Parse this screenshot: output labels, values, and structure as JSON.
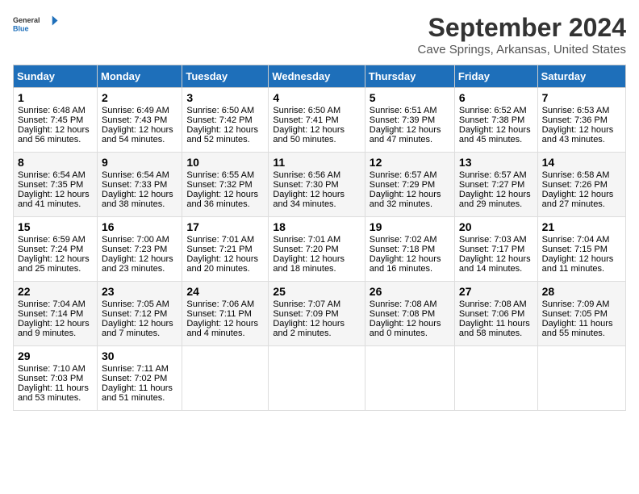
{
  "logo": {
    "line1": "General",
    "line2": "Blue"
  },
  "title": "September 2024",
  "subtitle": "Cave Springs, Arkansas, United States",
  "days_of_week": [
    "Sunday",
    "Monday",
    "Tuesday",
    "Wednesday",
    "Thursday",
    "Friday",
    "Saturday"
  ],
  "weeks": [
    [
      {
        "day": "1",
        "sunrise": "Sunrise: 6:48 AM",
        "sunset": "Sunset: 7:45 PM",
        "daylight": "Daylight: 12 hours and 56 minutes."
      },
      {
        "day": "2",
        "sunrise": "Sunrise: 6:49 AM",
        "sunset": "Sunset: 7:43 PM",
        "daylight": "Daylight: 12 hours and 54 minutes."
      },
      {
        "day": "3",
        "sunrise": "Sunrise: 6:50 AM",
        "sunset": "Sunset: 7:42 PM",
        "daylight": "Daylight: 12 hours and 52 minutes."
      },
      {
        "day": "4",
        "sunrise": "Sunrise: 6:50 AM",
        "sunset": "Sunset: 7:41 PM",
        "daylight": "Daylight: 12 hours and 50 minutes."
      },
      {
        "day": "5",
        "sunrise": "Sunrise: 6:51 AM",
        "sunset": "Sunset: 7:39 PM",
        "daylight": "Daylight: 12 hours and 47 minutes."
      },
      {
        "day": "6",
        "sunrise": "Sunrise: 6:52 AM",
        "sunset": "Sunset: 7:38 PM",
        "daylight": "Daylight: 12 hours and 45 minutes."
      },
      {
        "day": "7",
        "sunrise": "Sunrise: 6:53 AM",
        "sunset": "Sunset: 7:36 PM",
        "daylight": "Daylight: 12 hours and 43 minutes."
      }
    ],
    [
      {
        "day": "8",
        "sunrise": "Sunrise: 6:54 AM",
        "sunset": "Sunset: 7:35 PM",
        "daylight": "Daylight: 12 hours and 41 minutes."
      },
      {
        "day": "9",
        "sunrise": "Sunrise: 6:54 AM",
        "sunset": "Sunset: 7:33 PM",
        "daylight": "Daylight: 12 hours and 38 minutes."
      },
      {
        "day": "10",
        "sunrise": "Sunrise: 6:55 AM",
        "sunset": "Sunset: 7:32 PM",
        "daylight": "Daylight: 12 hours and 36 minutes."
      },
      {
        "day": "11",
        "sunrise": "Sunrise: 6:56 AM",
        "sunset": "Sunset: 7:30 PM",
        "daylight": "Daylight: 12 hours and 34 minutes."
      },
      {
        "day": "12",
        "sunrise": "Sunrise: 6:57 AM",
        "sunset": "Sunset: 7:29 PM",
        "daylight": "Daylight: 12 hours and 32 minutes."
      },
      {
        "day": "13",
        "sunrise": "Sunrise: 6:57 AM",
        "sunset": "Sunset: 7:27 PM",
        "daylight": "Daylight: 12 hours and 29 minutes."
      },
      {
        "day": "14",
        "sunrise": "Sunrise: 6:58 AM",
        "sunset": "Sunset: 7:26 PM",
        "daylight": "Daylight: 12 hours and 27 minutes."
      }
    ],
    [
      {
        "day": "15",
        "sunrise": "Sunrise: 6:59 AM",
        "sunset": "Sunset: 7:24 PM",
        "daylight": "Daylight: 12 hours and 25 minutes."
      },
      {
        "day": "16",
        "sunrise": "Sunrise: 7:00 AM",
        "sunset": "Sunset: 7:23 PM",
        "daylight": "Daylight: 12 hours and 23 minutes."
      },
      {
        "day": "17",
        "sunrise": "Sunrise: 7:01 AM",
        "sunset": "Sunset: 7:21 PM",
        "daylight": "Daylight: 12 hours and 20 minutes."
      },
      {
        "day": "18",
        "sunrise": "Sunrise: 7:01 AM",
        "sunset": "Sunset: 7:20 PM",
        "daylight": "Daylight: 12 hours and 18 minutes."
      },
      {
        "day": "19",
        "sunrise": "Sunrise: 7:02 AM",
        "sunset": "Sunset: 7:18 PM",
        "daylight": "Daylight: 12 hours and 16 minutes."
      },
      {
        "day": "20",
        "sunrise": "Sunrise: 7:03 AM",
        "sunset": "Sunset: 7:17 PM",
        "daylight": "Daylight: 12 hours and 14 minutes."
      },
      {
        "day": "21",
        "sunrise": "Sunrise: 7:04 AM",
        "sunset": "Sunset: 7:15 PM",
        "daylight": "Daylight: 12 hours and 11 minutes."
      }
    ],
    [
      {
        "day": "22",
        "sunrise": "Sunrise: 7:04 AM",
        "sunset": "Sunset: 7:14 PM",
        "daylight": "Daylight: 12 hours and 9 minutes."
      },
      {
        "day": "23",
        "sunrise": "Sunrise: 7:05 AM",
        "sunset": "Sunset: 7:12 PM",
        "daylight": "Daylight: 12 hours and 7 minutes."
      },
      {
        "day": "24",
        "sunrise": "Sunrise: 7:06 AM",
        "sunset": "Sunset: 7:11 PM",
        "daylight": "Daylight: 12 hours and 4 minutes."
      },
      {
        "day": "25",
        "sunrise": "Sunrise: 7:07 AM",
        "sunset": "Sunset: 7:09 PM",
        "daylight": "Daylight: 12 hours and 2 minutes."
      },
      {
        "day": "26",
        "sunrise": "Sunrise: 7:08 AM",
        "sunset": "Sunset: 7:08 PM",
        "daylight": "Daylight: 12 hours and 0 minutes."
      },
      {
        "day": "27",
        "sunrise": "Sunrise: 7:08 AM",
        "sunset": "Sunset: 7:06 PM",
        "daylight": "Daylight: 11 hours and 58 minutes."
      },
      {
        "day": "28",
        "sunrise": "Sunrise: 7:09 AM",
        "sunset": "Sunset: 7:05 PM",
        "daylight": "Daylight: 11 hours and 55 minutes."
      }
    ],
    [
      {
        "day": "29",
        "sunrise": "Sunrise: 7:10 AM",
        "sunset": "Sunset: 7:03 PM",
        "daylight": "Daylight: 11 hours and 53 minutes."
      },
      {
        "day": "30",
        "sunrise": "Sunrise: 7:11 AM",
        "sunset": "Sunset: 7:02 PM",
        "daylight": "Daylight: 11 hours and 51 minutes."
      },
      null,
      null,
      null,
      null,
      null
    ]
  ]
}
